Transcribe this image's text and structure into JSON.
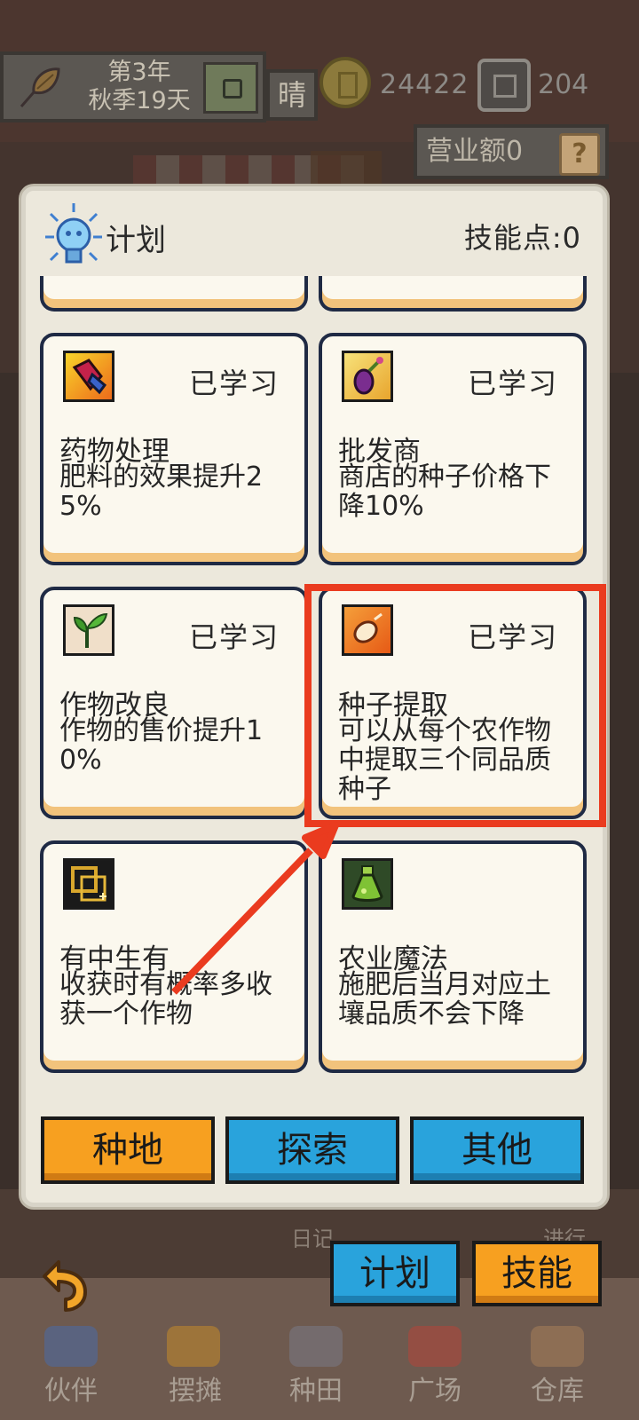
{
  "top_bar": {
    "year": "第3年",
    "season_day": "秋季19天",
    "weather": "晴",
    "coins": "24422",
    "gems": "204",
    "revenue": "营业额0",
    "help": "?"
  },
  "panel": {
    "title": "计划",
    "skill_points": "技能点:0",
    "cards": [
      {
        "icon": "medicine-icon",
        "status": "已学习",
        "name": "药物处理",
        "desc": "肥料的效果提升25%"
      },
      {
        "icon": "wholesale-icon",
        "status": "已学习",
        "name": "批发商",
        "desc": "商店的种子价格下降10%"
      },
      {
        "icon": "sprout-icon",
        "status": "已学习",
        "name": "作物改良",
        "desc": "作物的售价提升10%"
      },
      {
        "icon": "seed-icon",
        "status": "已学习",
        "name": "种子提取",
        "desc": "可以从每个农作物中提取三个同品质种子"
      },
      {
        "icon": "dice-icon",
        "status": "",
        "name": "有中生有",
        "desc": "收获时有概率多收获一个作物"
      },
      {
        "icon": "potion-icon",
        "status": "",
        "name": "农业魔法",
        "desc": "施肥后当月对应土壤品质不会下降"
      }
    ],
    "tabs": {
      "farm": "种地",
      "explore": "探索",
      "other": "其他"
    }
  },
  "bottom": {
    "diary": "日记",
    "progress": "进行",
    "plan_button": "计划",
    "skill_button": "技能",
    "nav": {
      "partner": "伙伴",
      "stall": "摆摊",
      "field": "种田",
      "plaza": "广场",
      "warehouse": "仓库"
    }
  },
  "colors": {
    "highlight": "#ea3b1f",
    "tab_active": "#f7a020",
    "tab_inactive": "#29a3dc",
    "card_border": "#1f2a44"
  }
}
